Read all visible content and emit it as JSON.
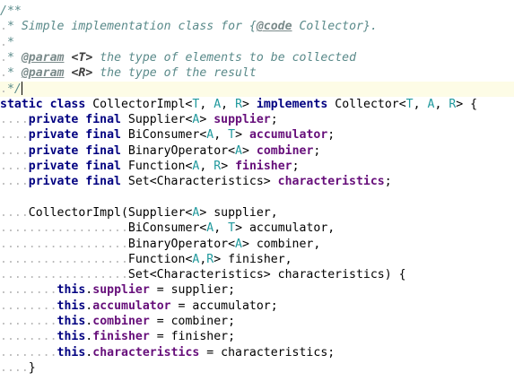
{
  "editor": {
    "language": "java",
    "current_line_color": "#fdfce6",
    "colors": {
      "keyword": "#000080",
      "field": "#660e7a",
      "type_parameter": "#20999d",
      "doc_comment": "#5a8a8a"
    },
    "lines": [
      {
        "indent": "",
        "tokens": [
          {
            "t": "/**",
            "c": "doc"
          }
        ]
      },
      {
        "indent": " ",
        "tokens": [
          {
            "t": "* Simple implementation class for {",
            "c": "doc"
          },
          {
            "t": "@code",
            "c": "doctag"
          },
          {
            "t": " Collector}.",
            "c": "doc"
          }
        ]
      },
      {
        "indent": " ",
        "tokens": [
          {
            "t": "*",
            "c": "doc"
          }
        ]
      },
      {
        "indent": " ",
        "tokens": [
          {
            "t": "* ",
            "c": "doc"
          },
          {
            "t": "@param",
            "c": "doctag"
          },
          {
            "t": " ",
            "c": "doc"
          },
          {
            "t": "<T>",
            "c": "docparam"
          },
          {
            "t": " the type of elements to be collected",
            "c": "doc"
          }
        ]
      },
      {
        "indent": " ",
        "tokens": [
          {
            "t": "* ",
            "c": "doc"
          },
          {
            "t": "@param",
            "c": "doctag"
          },
          {
            "t": " ",
            "c": "doc"
          },
          {
            "t": "<R>",
            "c": "docparam"
          },
          {
            "t": " the type of the result",
            "c": "doc"
          }
        ]
      },
      {
        "indent": " ",
        "tokens": [
          {
            "t": "*/",
            "c": "doc"
          }
        ],
        "current": true,
        "caret": true
      },
      {
        "indent": "",
        "tokens": [
          {
            "t": "static class",
            "c": "kw"
          },
          {
            "t": " CollectorImpl<",
            "c": ""
          },
          {
            "t": "T",
            "c": "tp"
          },
          {
            "t": ", ",
            "c": ""
          },
          {
            "t": "A",
            "c": "tp"
          },
          {
            "t": ", ",
            "c": ""
          },
          {
            "t": "R",
            "c": "tp"
          },
          {
            "t": "> ",
            "c": ""
          },
          {
            "t": "implements",
            "c": "kw"
          },
          {
            "t": " Collector<",
            "c": ""
          },
          {
            "t": "T",
            "c": "tp"
          },
          {
            "t": ", ",
            "c": ""
          },
          {
            "t": "A",
            "c": "tp"
          },
          {
            "t": ", ",
            "c": ""
          },
          {
            "t": "R",
            "c": "tp"
          },
          {
            "t": "> {",
            "c": ""
          }
        ]
      },
      {
        "indent": "    ",
        "tokens": [
          {
            "t": "private final",
            "c": "kw"
          },
          {
            "t": " Supplier<",
            "c": ""
          },
          {
            "t": "A",
            "c": "tp"
          },
          {
            "t": "> ",
            "c": ""
          },
          {
            "t": "supplier",
            "c": "field"
          },
          {
            "t": ";",
            "c": ""
          }
        ]
      },
      {
        "indent": "    ",
        "tokens": [
          {
            "t": "private final",
            "c": "kw"
          },
          {
            "t": " BiConsumer<",
            "c": ""
          },
          {
            "t": "A",
            "c": "tp"
          },
          {
            "t": ", ",
            "c": ""
          },
          {
            "t": "T",
            "c": "tp"
          },
          {
            "t": "> ",
            "c": ""
          },
          {
            "t": "accumulator",
            "c": "field"
          },
          {
            "t": ";",
            "c": ""
          }
        ]
      },
      {
        "indent": "    ",
        "tokens": [
          {
            "t": "private final",
            "c": "kw"
          },
          {
            "t": " BinaryOperator<",
            "c": ""
          },
          {
            "t": "A",
            "c": "tp"
          },
          {
            "t": "> ",
            "c": ""
          },
          {
            "t": "combiner",
            "c": "field"
          },
          {
            "t": ";",
            "c": ""
          }
        ]
      },
      {
        "indent": "    ",
        "tokens": [
          {
            "t": "private final",
            "c": "kw"
          },
          {
            "t": " Function<",
            "c": ""
          },
          {
            "t": "A",
            "c": "tp"
          },
          {
            "t": ", ",
            "c": ""
          },
          {
            "t": "R",
            "c": "tp"
          },
          {
            "t": "> ",
            "c": ""
          },
          {
            "t": "finisher",
            "c": "field"
          },
          {
            "t": ";",
            "c": ""
          }
        ]
      },
      {
        "indent": "    ",
        "tokens": [
          {
            "t": "private final",
            "c": "kw"
          },
          {
            "t": " Set<Characteristics> ",
            "c": ""
          },
          {
            "t": "characteristics",
            "c": "field"
          },
          {
            "t": ";",
            "c": ""
          }
        ]
      },
      {
        "indent": "",
        "tokens": []
      },
      {
        "indent": "    ",
        "tokens": [
          {
            "t": "CollectorImpl(Supplier<",
            "c": ""
          },
          {
            "t": "A",
            "c": "tp"
          },
          {
            "t": "> supplier,",
            "c": ""
          }
        ]
      },
      {
        "indent": "                  ",
        "tokens": [
          {
            "t": "BiConsumer<",
            "c": ""
          },
          {
            "t": "A",
            "c": "tp"
          },
          {
            "t": ", ",
            "c": ""
          },
          {
            "t": "T",
            "c": "tp"
          },
          {
            "t": "> accumulator,",
            "c": ""
          }
        ]
      },
      {
        "indent": "                  ",
        "tokens": [
          {
            "t": "BinaryOperator<",
            "c": ""
          },
          {
            "t": "A",
            "c": "tp"
          },
          {
            "t": "> combiner,",
            "c": ""
          }
        ]
      },
      {
        "indent": "                  ",
        "tokens": [
          {
            "t": "Function<",
            "c": ""
          },
          {
            "t": "A",
            "c": "tp"
          },
          {
            "t": ",",
            "c": ""
          },
          {
            "t": "R",
            "c": "tp"
          },
          {
            "t": "> finisher,",
            "c": ""
          }
        ]
      },
      {
        "indent": "                  ",
        "tokens": [
          {
            "t": "Set<Characteristics> characteristics) {",
            "c": ""
          }
        ]
      },
      {
        "indent": "        ",
        "tokens": [
          {
            "t": "this",
            "c": "kw"
          },
          {
            "t": ".",
            "c": ""
          },
          {
            "t": "supplier",
            "c": "field"
          },
          {
            "t": " = supplier;",
            "c": ""
          }
        ]
      },
      {
        "indent": "        ",
        "tokens": [
          {
            "t": "this",
            "c": "kw"
          },
          {
            "t": ".",
            "c": ""
          },
          {
            "t": "accumulator",
            "c": "field"
          },
          {
            "t": " = accumulator;",
            "c": ""
          }
        ]
      },
      {
        "indent": "        ",
        "tokens": [
          {
            "t": "this",
            "c": "kw"
          },
          {
            "t": ".",
            "c": ""
          },
          {
            "t": "combiner",
            "c": "field"
          },
          {
            "t": " = combiner;",
            "c": ""
          }
        ]
      },
      {
        "indent": "        ",
        "tokens": [
          {
            "t": "this",
            "c": "kw"
          },
          {
            "t": ".",
            "c": ""
          },
          {
            "t": "finisher",
            "c": "field"
          },
          {
            "t": " = finisher;",
            "c": ""
          }
        ]
      },
      {
        "indent": "        ",
        "tokens": [
          {
            "t": "this",
            "c": "kw"
          },
          {
            "t": ".",
            "c": ""
          },
          {
            "t": "characteristics",
            "c": "field"
          },
          {
            "t": " = characteristics;",
            "c": ""
          }
        ]
      },
      {
        "indent": "    ",
        "tokens": [
          {
            "t": "}",
            "c": ""
          }
        ]
      }
    ]
  }
}
